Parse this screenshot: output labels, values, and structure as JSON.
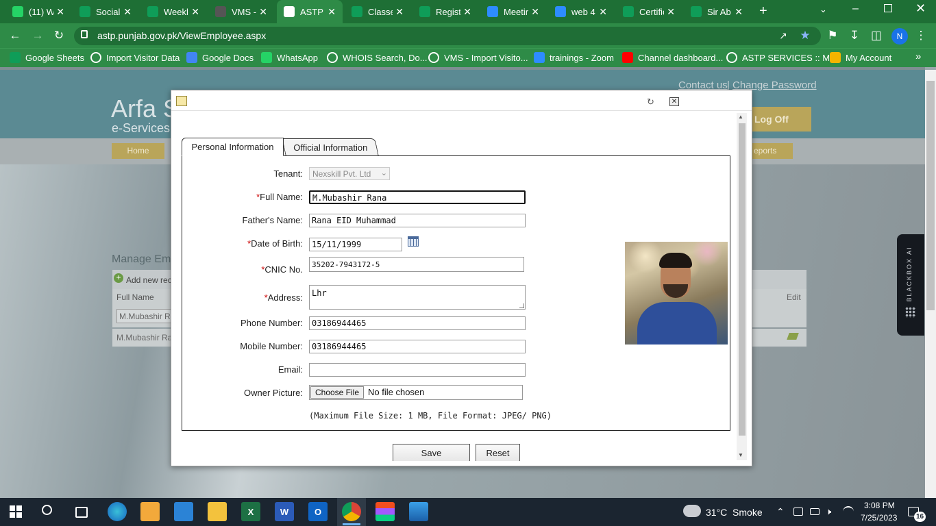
{
  "browser": {
    "tabs": [
      {
        "label": "(11) W",
        "icon": "whatsapp-icon",
        "color": "#25d366"
      },
      {
        "label": "Social",
        "icon": "sheets-icon",
        "color": "#0f9d58"
      },
      {
        "label": "Weekl",
        "icon": "sheets-icon",
        "color": "#0f9d58"
      },
      {
        "label": "VMS -",
        "icon": "globe-icon",
        "color": "#555"
      },
      {
        "label": "ASTP S",
        "icon": "globe-icon",
        "color": "#fff"
      },
      {
        "label": "Classe",
        "icon": "sheets-icon",
        "color": "#0f9d58"
      },
      {
        "label": "Regist",
        "icon": "sheets-icon",
        "color": "#0f9d58"
      },
      {
        "label": "Meetir",
        "icon": "zoom-icon",
        "color": "#2d8cff"
      },
      {
        "label": "web 4",
        "icon": "zoom-video-icon",
        "color": "#2d8cff"
      },
      {
        "label": "Certific",
        "icon": "sheets-icon",
        "color": "#0f9d58"
      },
      {
        "label": "Sir Ab",
        "icon": "sheets-icon",
        "color": "#0f9d58"
      }
    ],
    "url": "astp.punjab.gov.pk/ViewEmployee.aspx",
    "profile_initial": "N",
    "bookmarks": [
      {
        "label": "Google Sheets",
        "icon": "sheets-icon"
      },
      {
        "label": "Import Visitor Data",
        "icon": "globe-icon"
      },
      {
        "label": "Google Docs",
        "icon": "docs-icon"
      },
      {
        "label": "WhatsApp",
        "icon": "whatsapp-icon"
      },
      {
        "label": "WHOIS Search, Do...",
        "icon": "globe-icon"
      },
      {
        "label": "VMS - Import Visito...",
        "icon": "globe-icon"
      },
      {
        "label": "trainings - Zoom",
        "icon": "zoom-icon"
      },
      {
        "label": "Channel dashboard...",
        "icon": "youtube-icon"
      },
      {
        "label": "ASTP SERVICES :: M...",
        "icon": "globe-icon"
      },
      {
        "label": "My Account",
        "icon": "g-icon"
      }
    ]
  },
  "site": {
    "logo_title": "Arfa S",
    "logo_sub": "e-Services",
    "contact_link": "Contact us",
    "separator": "|",
    "change_password_link": "Change Password",
    "logoff_label": "Log Off",
    "menu_home": "Home",
    "menu_reports": "eports",
    "manage_title": "Manage Em",
    "add_new": "Add new rec",
    "col_fullname": "Full Name",
    "col_edit": "Edit",
    "filter_value": "M.Mubashir Ra",
    "row_value": "M.Mubashir Ra"
  },
  "dialog": {
    "tabs": [
      "Personal Information",
      "Official Information"
    ],
    "fields": {
      "tenant": {
        "label": "Tenant:",
        "value": "Nexskill Pvt. Ltd"
      },
      "full_name": {
        "label": "Full Name:",
        "value": "M.Mubashir Rana"
      },
      "father_name": {
        "label": "Father's Name:",
        "value": "Rana EID Muhammad"
      },
      "dob": {
        "label": "Date of Birth:",
        "value": "15/11/1999"
      },
      "cnic": {
        "label": "CNIC No.",
        "value": "35202-7943172-5"
      },
      "address": {
        "label": "Address:",
        "value": "Lhr"
      },
      "phone": {
        "label": "Phone Number:",
        "value": "03186944465"
      },
      "mobile": {
        "label": "Mobile Number:",
        "value": "03186944465"
      },
      "email": {
        "label": "Email:",
        "value": ""
      },
      "picture": {
        "label": "Owner Picture:",
        "button": "Choose File",
        "status": "No file chosen"
      }
    },
    "required_mark": "*",
    "file_hint": "(Maximum File Size: 1 MB, File Format: JPEG/ PNG)",
    "save_label": "Save",
    "reset_label": "Reset"
  },
  "blackbox": {
    "label": "BLACKBOX AI"
  },
  "taskbar": {
    "weather": "31°C  Smoke",
    "time": "3:08 PM",
    "date": "7/25/2023",
    "notifications": "16"
  }
}
